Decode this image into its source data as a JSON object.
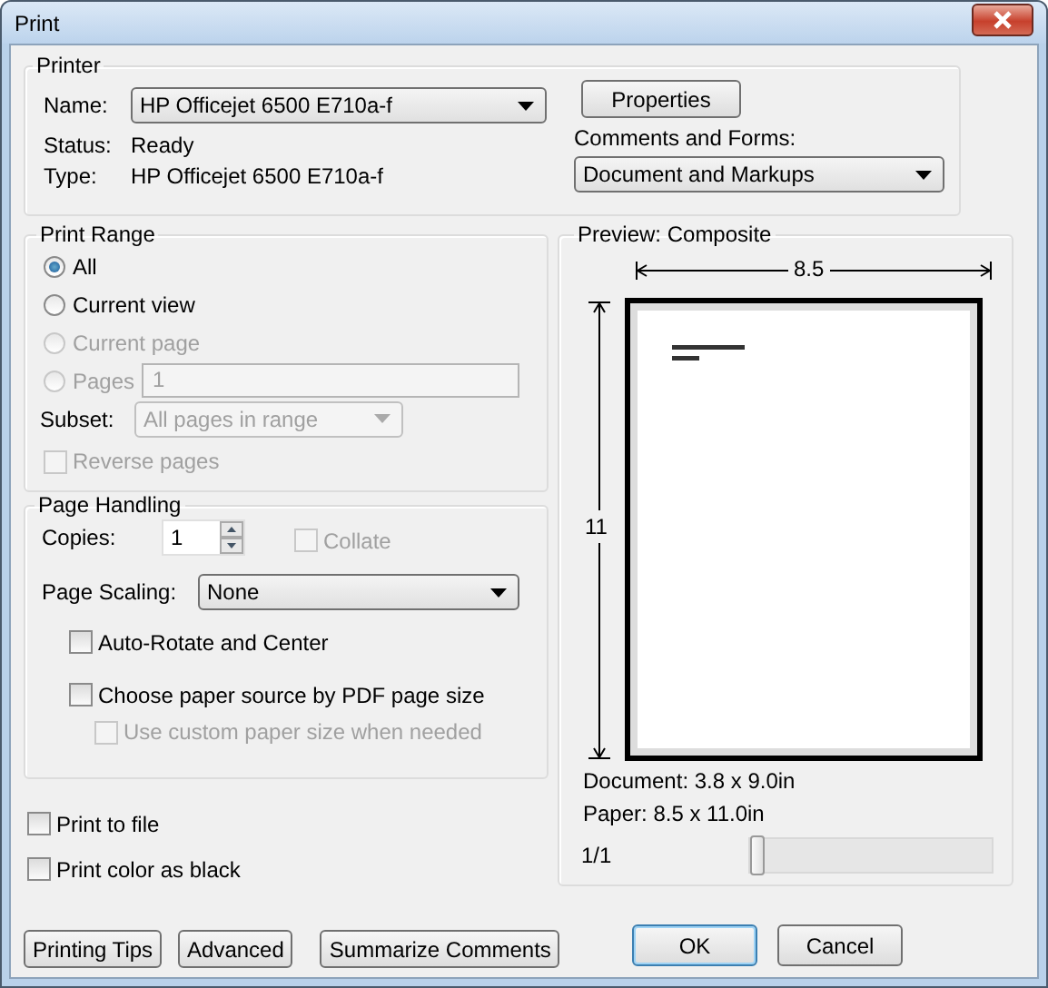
{
  "window": {
    "title": "Print"
  },
  "printer": {
    "legend": "Printer",
    "name_label": "Name:",
    "name_value": "HP Officejet 6500 E710a-f",
    "properties_button": "Properties",
    "status_label": "Status:",
    "status_value": "Ready",
    "type_label": "Type:",
    "type_value": "HP Officejet 6500 E710a-f",
    "comments_label": "Comments and Forms:",
    "comments_value": "Document and Markups"
  },
  "print_range": {
    "legend": "Print Range",
    "options": [
      {
        "label": "All",
        "selected": true,
        "disabled": false
      },
      {
        "label": "Current view",
        "selected": false,
        "disabled": false
      },
      {
        "label": "Current page",
        "selected": false,
        "disabled": true
      },
      {
        "label": "Pages",
        "selected": false,
        "disabled": true,
        "field": {
          "value": "1"
        }
      }
    ],
    "subset_label": "Subset:",
    "subset": {
      "value": "All pages in range",
      "disabled": true
    },
    "reverse": {
      "label": "Reverse pages",
      "checked": false,
      "disabled": true
    }
  },
  "page_handling": {
    "legend": "Page Handling",
    "copies_label": "Copies:",
    "copies_value": "1",
    "collate": {
      "label": "Collate",
      "checked": false,
      "disabled": true
    },
    "scaling_label": "Page Scaling:",
    "scaling_value": "None",
    "checkboxes": [
      {
        "label": "Auto-Rotate and Center",
        "checked": false,
        "disabled": false
      },
      {
        "label": "Choose paper source by PDF page size",
        "checked": false,
        "disabled": false,
        "children": [
          {
            "label": "Use custom paper size when needed",
            "checked": false,
            "disabled": true
          }
        ]
      }
    ]
  },
  "options": [
    {
      "label": "Print to file",
      "checked": false
    },
    {
      "label": "Print color as black",
      "checked": false
    }
  ],
  "preview": {
    "legend": "Preview: Composite",
    "width_label": "8.5",
    "height_label": "11",
    "document": "Document: 3.8 x 9.0in",
    "paper": "Paper: 8.5 x 11.0in",
    "page_indicator": "1/1",
    "level": 0
  },
  "buttons": [
    {
      "label": "Printing Tips"
    },
    {
      "label": "Advanced"
    },
    {
      "label": "Summarize Comments"
    }
  ],
  "dialog_buttons": [
    {
      "label": "OK",
      "default": true
    },
    {
      "label": "Cancel",
      "default": false
    }
  ]
}
